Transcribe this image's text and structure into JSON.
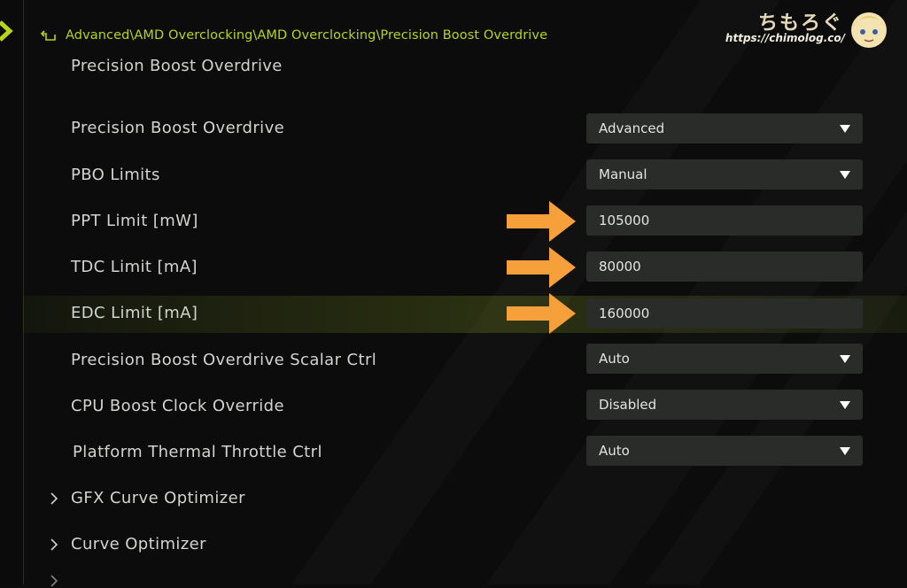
{
  "breadcrumb": "Advanced\\AMD Overclocking\\AMD Overclocking\\Precision Boost Overdrive",
  "page_title": "Precision Boost Overdrive",
  "watermark": {
    "title": "ちもろぐ",
    "url": "https://chimolog.co/"
  },
  "settings": [
    {
      "label": "Precision Boost Overdrive",
      "value": "Advanced",
      "kind": "dropdown"
    },
    {
      "label": "PBO Limits",
      "value": "Manual",
      "kind": "dropdown"
    },
    {
      "label": "PPT Limit [mW]",
      "value": "105000",
      "kind": "input"
    },
    {
      "label": "TDC Limit [mA]",
      "value": "80000",
      "kind": "input"
    },
    {
      "label": "EDC Limit [mA]",
      "value": "160000",
      "kind": "input"
    },
    {
      "label": "Precision Boost Overdrive Scalar Ctrl",
      "value": "Auto",
      "kind": "dropdown"
    },
    {
      "label": "CPU Boost Clock Override",
      "value": "Disabled",
      "kind": "dropdown"
    },
    {
      "label": "Platform Thermal Throttle Ctrl",
      "value": "Auto",
      "kind": "dropdown"
    }
  ],
  "submenus": [
    {
      "label": "GFX Curve Optimizer"
    },
    {
      "label": "Curve Optimizer"
    }
  ],
  "colors": {
    "accent": "#b9d419",
    "arrow": "#f5a03a",
    "control_bg": "#2a2c2a"
  }
}
